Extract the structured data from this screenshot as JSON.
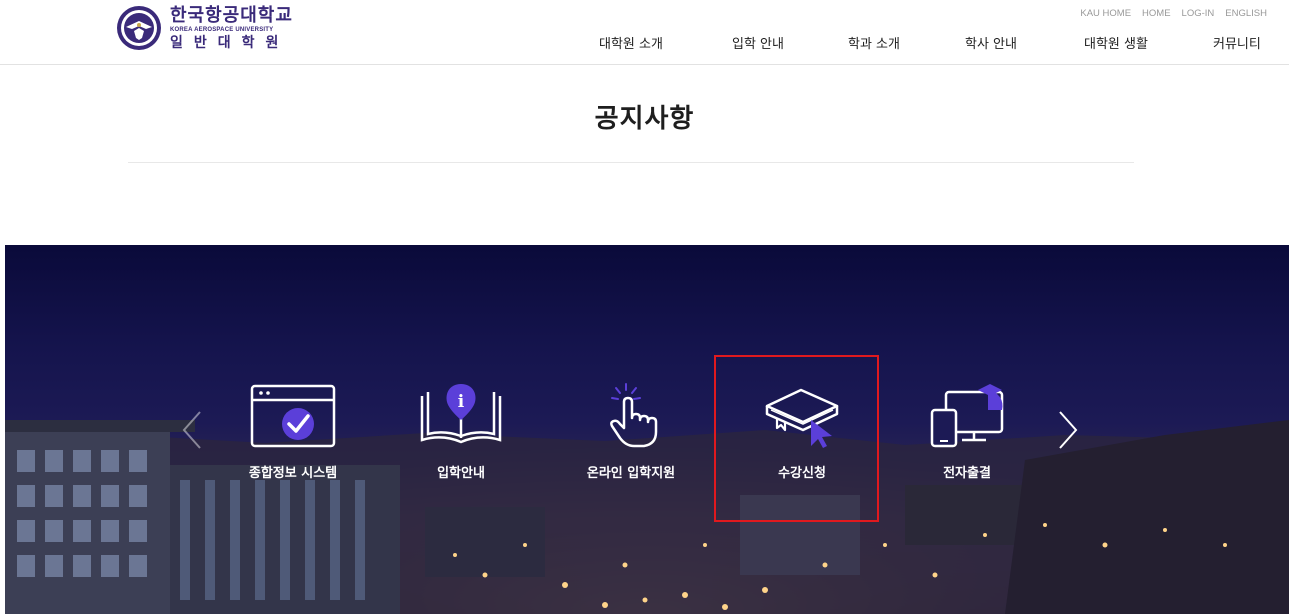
{
  "header": {
    "logo": {
      "korean_name": "한국항공대학교",
      "english_name": "KOREA AEROSPACE UNIVERSITY",
      "sub_name": "일반대학원"
    },
    "util_links": [
      "KAU HOME",
      "HOME",
      "LOG-IN",
      "ENGLISH"
    ],
    "nav": [
      "대학원 소개",
      "입학 안내",
      "학과 소개",
      "학사 안내",
      "대학원 생활",
      "커뮤니티"
    ]
  },
  "page_title": "공지사항",
  "quick_menu": {
    "items": [
      {
        "label": "종합정보 시스템",
        "icon": "browser-check-icon"
      },
      {
        "label": "입학안내",
        "icon": "book-info-icon"
      },
      {
        "label": "온라인 입학지원",
        "icon": "hand-pointer-icon"
      },
      {
        "label": "수강신청",
        "icon": "book-cursor-icon"
      },
      {
        "label": "전자출결",
        "icon": "devices-graduation-icon"
      }
    ],
    "prev_icon": "chevron-left-icon",
    "next_icon": "chevron-right-icon",
    "highlight_color": "#e0191e",
    "icon_accent": "#5b3fd9"
  }
}
